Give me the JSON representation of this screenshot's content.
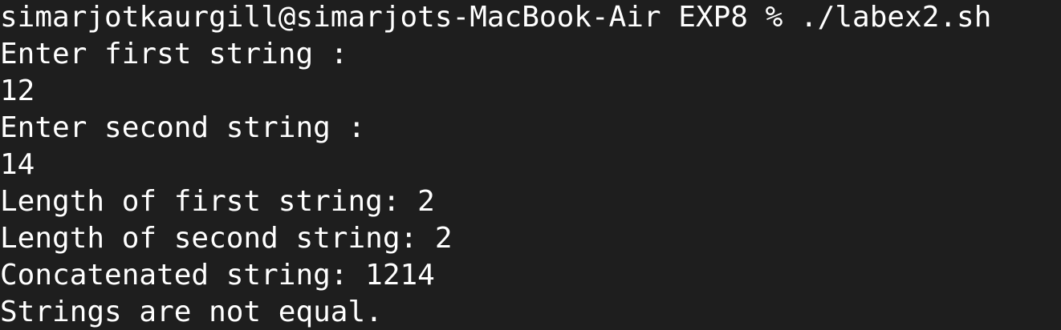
{
  "terminal": {
    "background": "#1e1e1e",
    "foreground": "#ffffff",
    "lines": [
      "simarjotkaurgill@simarjots-MacBook-Air EXP8 % ./labex2.sh",
      "Enter first string :",
      "12",
      "Enter second string :",
      "14",
      "Length of first string: 2",
      "Length of second string: 2",
      "Concatenated string: 1214",
      "Strings are not equal."
    ]
  }
}
